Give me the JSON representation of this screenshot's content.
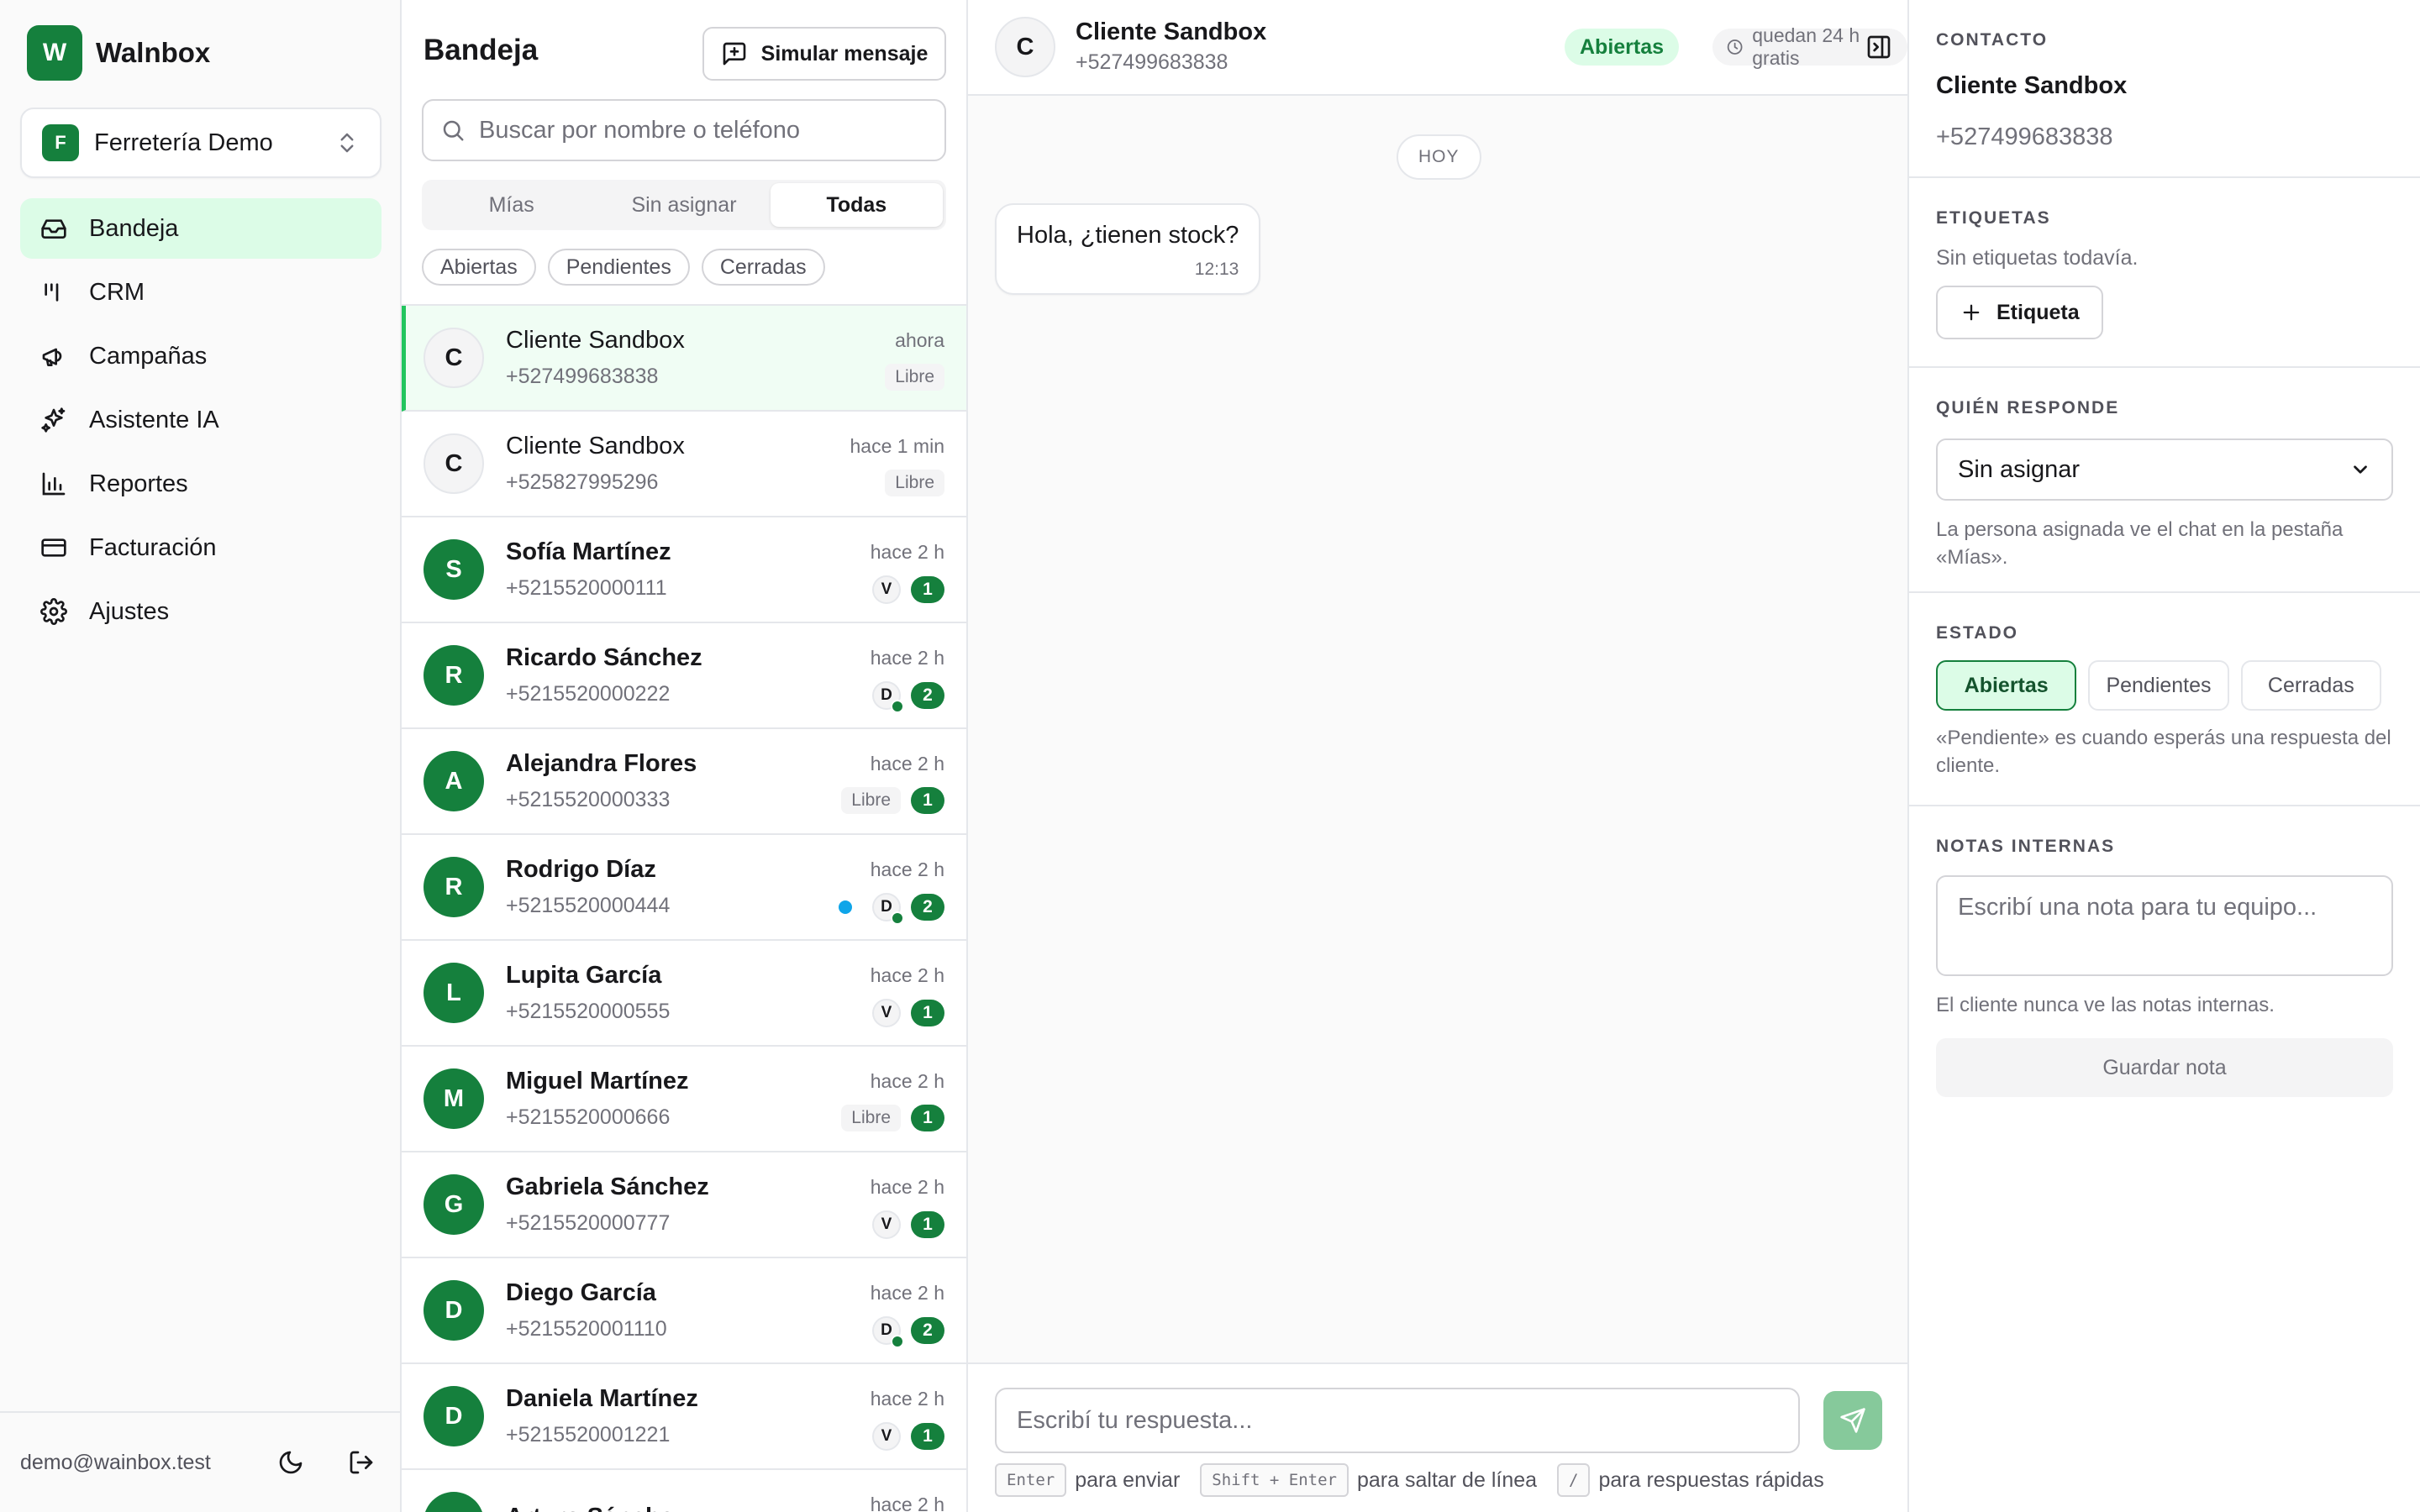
{
  "brand": {
    "logo_letter": "W",
    "name": "Walnbox"
  },
  "workspace": {
    "badge": "F",
    "name": "Ferretería Demo"
  },
  "nav": [
    {
      "icon": "inbox-icon",
      "label": "Bandeja",
      "active": true
    },
    {
      "icon": "crm-icon",
      "label": "CRM"
    },
    {
      "icon": "megaphone-icon",
      "label": "Campañas"
    },
    {
      "icon": "sparkles-icon",
      "label": "Asistente IA"
    },
    {
      "icon": "bar-chart-icon",
      "label": "Reportes"
    },
    {
      "icon": "credit-card-icon",
      "label": "Facturación"
    },
    {
      "icon": "gear-icon",
      "label": "Ajustes"
    }
  ],
  "footer": {
    "email": "demo@wainbox.test"
  },
  "inbox": {
    "title": "Bandeja",
    "simulate_label": "Simular mensaje",
    "search_placeholder": "Buscar por nombre o teléfono",
    "tabs": [
      {
        "label": "Mías"
      },
      {
        "label": "Sin asignar"
      },
      {
        "label": "Todas",
        "active": true
      }
    ],
    "filters": [
      "Abiertas",
      "Pendientes",
      "Cerradas"
    ],
    "conversations": [
      {
        "initial": "C",
        "name": "Cliente Sandbox",
        "phone": "+527499683838",
        "time": "ahora",
        "assignee": "Libre",
        "selected": true,
        "style": "grey"
      },
      {
        "initial": "C",
        "name": "Cliente Sandbox",
        "phone": "+525827995296",
        "time": "hace 1 min",
        "assignee": "Libre",
        "style": "grey"
      },
      {
        "initial": "S",
        "name": "Sofía Martínez",
        "phone": "+5215520000111",
        "time": "hace 2 h",
        "agent": "V",
        "unread": "1",
        "style": "green"
      },
      {
        "initial": "R",
        "name": "Ricardo Sánchez",
        "phone": "+5215520000222",
        "time": "hace 2 h",
        "agent": "D",
        "agent_online": true,
        "unread": "2",
        "style": "green"
      },
      {
        "initial": "A",
        "name": "Alejandra Flores",
        "phone": "+5215520000333",
        "time": "hace 2 h",
        "assignee": "Libre",
        "unread": "1",
        "style": "green"
      },
      {
        "initial": "R",
        "name": "Rodrigo Díaz",
        "phone": "+5215520000444",
        "time": "hace 2 h",
        "agent": "D",
        "agent_online": true,
        "unread": "2",
        "blue_dot": true,
        "style": "green"
      },
      {
        "initial": "L",
        "name": "Lupita García",
        "phone": "+5215520000555",
        "time": "hace 2 h",
        "agent": "V",
        "unread": "1",
        "style": "green"
      },
      {
        "initial": "M",
        "name": "Miguel Martínez",
        "phone": "+5215520000666",
        "time": "hace 2 h",
        "assignee": "Libre",
        "unread": "1",
        "style": "green"
      },
      {
        "initial": "G",
        "name": "Gabriela Sánchez",
        "phone": "+5215520000777",
        "time": "hace 2 h",
        "agent": "V",
        "unread": "1",
        "style": "green"
      },
      {
        "initial": "D",
        "name": "Diego García",
        "phone": "+5215520001110",
        "time": "hace 2 h",
        "agent": "D",
        "agent_online": true,
        "unread": "2",
        "style": "green"
      },
      {
        "initial": "D",
        "name": "Daniela Martínez",
        "phone": "+5215520001221",
        "time": "hace 2 h",
        "agent": "V",
        "unread": "1",
        "style": "green"
      },
      {
        "initial": "A",
        "name": "Arturo Sánchez",
        "phone": "",
        "time": "hace 2 h",
        "style": "green"
      }
    ]
  },
  "chat": {
    "avatar": "C",
    "name": "Cliente Sandbox",
    "phone": "+527499683838",
    "status": "Abiertas",
    "window_text": "quedan 24 h gratis",
    "day_label": "HOY",
    "message": {
      "text": "Hola, ¿tienen stock?",
      "time": "12:13"
    },
    "reply_placeholder": "Escribí tu respuesta...",
    "hints": [
      {
        "key": "Enter",
        "text": "para enviar"
      },
      {
        "key": "Shift + Enter",
        "text": "para saltar de línea"
      },
      {
        "key": "/",
        "text": "para respuestas rápidas"
      }
    ]
  },
  "panel": {
    "contact_title": "CONTACTO",
    "contact_name": "Cliente Sandbox",
    "contact_phone": "+527499683838",
    "tags_title": "ETIQUETAS",
    "tags_empty": "Sin etiquetas todavía.",
    "tag_button": "Etiqueta",
    "assign_title": "QUIÉN RESPONDE",
    "assign_value": "Sin asignar",
    "assign_help": "La persona asignada ve el chat en la pestaña «Mías».",
    "status_title": "ESTADO",
    "status_options": [
      {
        "label": "Abiertas",
        "active": true
      },
      {
        "label": "Pendientes"
      },
      {
        "label": "Cerradas"
      }
    ],
    "status_help": "«Pendiente» es cuando esperás una respuesta del cliente.",
    "notes_title": "NOTAS INTERNAS",
    "notes_placeholder": "Escribí una nota para tu equipo...",
    "notes_help": "El cliente nunca ve las notas internas.",
    "save_label": "Guardar nota"
  }
}
